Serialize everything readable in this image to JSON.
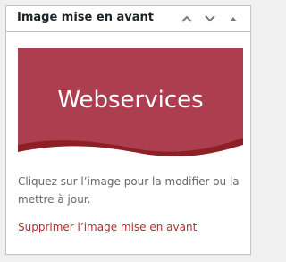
{
  "postbox": {
    "title": "Image mise en avant",
    "actions": [
      {
        "name": "move-up",
        "icon": "chevron-up-icon"
      },
      {
        "name": "move-down",
        "icon": "chevron-down-icon"
      },
      {
        "name": "toggle-panel",
        "icon": "triangle-up-icon"
      }
    ]
  },
  "featured_image": {
    "text": "Webservices",
    "background_color": "#ad3e4f",
    "wave_color": "#8d1f27"
  },
  "help_text": "Cliquez sur l’image pour la modifier ou la mettre à jour.",
  "remove_link": "Supprimer l’image mise en avant"
}
